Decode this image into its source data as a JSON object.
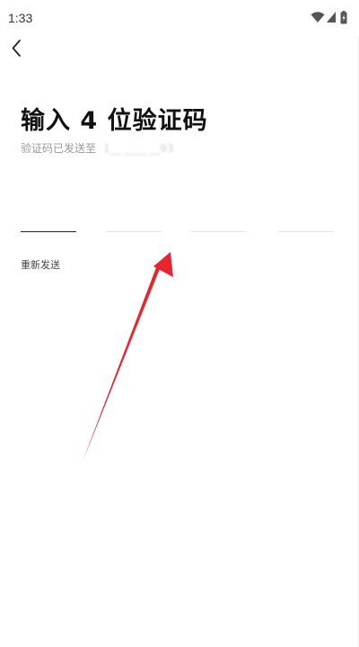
{
  "status_bar": {
    "time": "1:33",
    "icons": [
      "wifi-icon",
      "signal-icon",
      "battery-icon"
    ]
  },
  "header": {
    "back_icon": "chevron-left-icon"
  },
  "main": {
    "title": "输入 4 位验证码",
    "subtitle_prefix": "验证码已发送至",
    "phone_masked": "1__ ____ __93",
    "code_cells": [
      "",
      "",
      "",
      ""
    ],
    "active_cell_index": 0,
    "resend_label": "重新发送"
  },
  "annotation": {
    "arrow_color": "#e8252e"
  },
  "colors": {
    "background": "#ffffff",
    "title_text": "#111111",
    "subtitle_text": "#999999",
    "active_underline": "#222222",
    "inactive_underline": "#e4e4e4"
  }
}
